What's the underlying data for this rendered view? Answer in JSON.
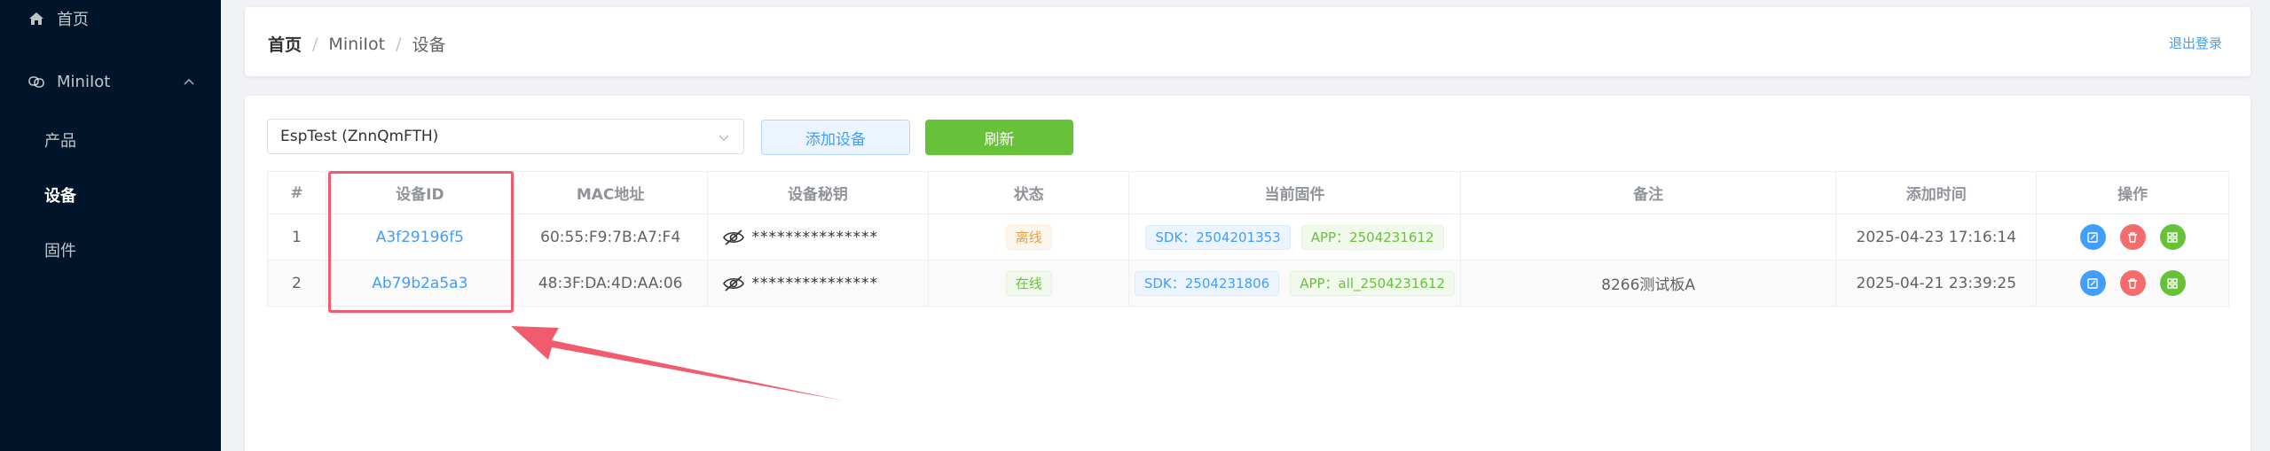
{
  "sidebar": {
    "home": {
      "label": "首页",
      "icon": "home-icon"
    },
    "group": {
      "label": "MiniIot",
      "icon": "link-icon",
      "chevron": "chevron-up-icon"
    },
    "items": [
      {
        "label": "产品",
        "active": false
      },
      {
        "label": "设备",
        "active": true
      },
      {
        "label": "固件",
        "active": false
      }
    ],
    "bg_color": "#001529"
  },
  "header": {
    "breadcrumb": [
      "首页",
      "MiniIot",
      "设备"
    ],
    "separator": "/",
    "logout_label": "退出登录"
  },
  "toolbar": {
    "select_value": "EspTest (ZnnQmFTH)",
    "add_label": "添加设备",
    "refresh_label": "刷新"
  },
  "table": {
    "columns": [
      "#",
      "设备ID",
      "MAC地址",
      "设备秘钥",
      "状态",
      "当前固件",
      "备注",
      "添加时间",
      "操作"
    ],
    "rows": [
      {
        "index": "1",
        "device_id": "A3f29196f5",
        "mac": "60:55:F9:7B:A7:F4",
        "secret": "***************",
        "status": "离线",
        "sdk": "SDK：2504201353",
        "app": "APP：2504231612",
        "note": "",
        "added": "2025-04-23 17:16:14"
      },
      {
        "index": "2",
        "device_id": "Ab79b2a5a3",
        "mac": "48:3F:DA:4D:AA:06",
        "secret": "***************",
        "status": "在线",
        "sdk": "SDK：2504231806",
        "app": "APP：all_2504231612",
        "note": "8266测试板A",
        "added": "2025-04-21 23:39:25"
      }
    ]
  },
  "colors": {
    "accent": "#409eff",
    "success": "#67c23a",
    "danger": "#f56c6c",
    "warning": "#e6a23c",
    "annotation": "#f25a6e"
  }
}
